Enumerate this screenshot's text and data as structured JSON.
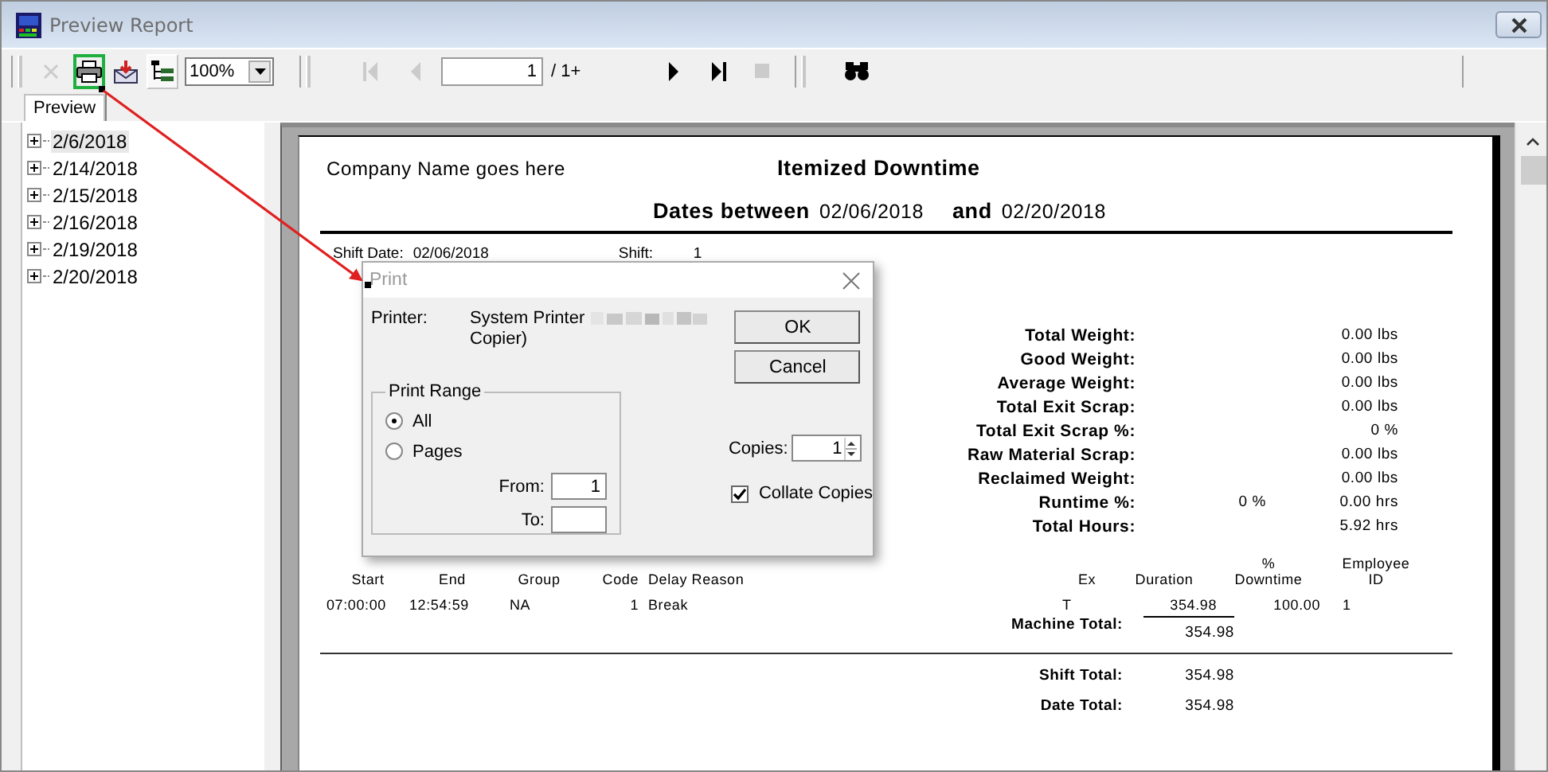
{
  "window": {
    "title": "Preview Report"
  },
  "toolbar": [
    {
      "kind": "close",
      "disabled": true
    },
    {
      "kind": "print",
      "disabled": false,
      "highlighted": true
    },
    {
      "kind": "export",
      "disabled": false
    },
    {
      "kind": "tree",
      "pressed": true
    },
    {
      "kind": "zoom",
      "value": "100%"
    },
    {
      "kind": "first",
      "disabled": true
    },
    {
      "kind": "prev",
      "disabled": true
    },
    {
      "kind": "page",
      "value": "1",
      "suffix": "/ 1+"
    },
    {
      "kind": "next",
      "disabled": false
    },
    {
      "kind": "last",
      "disabled": false
    },
    {
      "kind": "stop",
      "disabled": true
    },
    {
      "kind": "find",
      "disabled": false
    }
  ],
  "tabs": [
    {
      "label": "Preview",
      "selected": true
    }
  ],
  "tree": {
    "items": [
      {
        "label": "2/6/2018",
        "selected": true,
        "expanded": false
      },
      {
        "label": "2/14/2018",
        "selected": false,
        "expanded": false
      },
      {
        "label": "2/15/2018",
        "selected": false,
        "expanded": false
      },
      {
        "label": "2/16/2018",
        "selected": false,
        "expanded": false
      },
      {
        "label": "2/19/2018",
        "selected": false,
        "expanded": false
      },
      {
        "label": "2/20/2018",
        "selected": false,
        "expanded": false
      }
    ]
  },
  "report": {
    "company": "Company Name goes here",
    "title": "Itemized Downtime",
    "dates_label": "Dates between",
    "date_from": "02/06/2018",
    "and_label": "and",
    "date_to": "02/20/2018",
    "shift_date_label": "Shift Date:",
    "shift_date": "02/06/2018",
    "shift_label": "Shift:",
    "shift": "1",
    "stats": [
      {
        "label": "Total Weight:",
        "value": "0.00 lbs"
      },
      {
        "label": "Good Weight:",
        "value": "0.00 lbs"
      },
      {
        "label": "Average Weight:",
        "value": "0.00 lbs"
      },
      {
        "label": "Total Exit Scrap:",
        "value": "0.00 lbs"
      },
      {
        "label": "Total Exit Scrap %:",
        "value": "0 %"
      },
      {
        "label": "Raw Material Scrap:",
        "value": "0.00 lbs"
      },
      {
        "label": "Reclaimed Weight:",
        "value": "0.00 lbs"
      },
      {
        "label": "Runtime %:",
        "percent": "0 %",
        "value": "0.00 hrs"
      },
      {
        "label": "Total Hours:",
        "value": "5.92 hrs"
      }
    ],
    "columns": [
      "Start",
      "End",
      "Group",
      "Code",
      "Delay Reason",
      "Ex",
      "Duration",
      "% Downtime",
      "Employee ID"
    ],
    "rows": [
      [
        "07:00:00",
        "12:54:59",
        "NA",
        "1",
        "Break",
        "T",
        "354.98",
        "100.00",
        "1"
      ]
    ],
    "machine_total_label": "Machine Total:",
    "machine_total": "354.98",
    "shift_total_label": "Shift Total:",
    "shift_total": "354.98",
    "date_total_label": "Date Total:",
    "date_total": "354.98"
  },
  "dialog": {
    "title": "Print",
    "printer_label": "Printer:",
    "printer_name": "System Printer",
    "printer_name_end": "Copier)",
    "ok": "OK",
    "cancel": "Cancel",
    "range_title": "Print Range",
    "range_options": [
      {
        "label": "All",
        "selected": true
      },
      {
        "label": "Pages",
        "selected": false
      }
    ],
    "from_label": "From:",
    "from_value": "1",
    "to_label": "To:",
    "copies_label": "Copies:",
    "copies": "1",
    "collate": {
      "label": "Collate Copies",
      "checked": true
    }
  }
}
